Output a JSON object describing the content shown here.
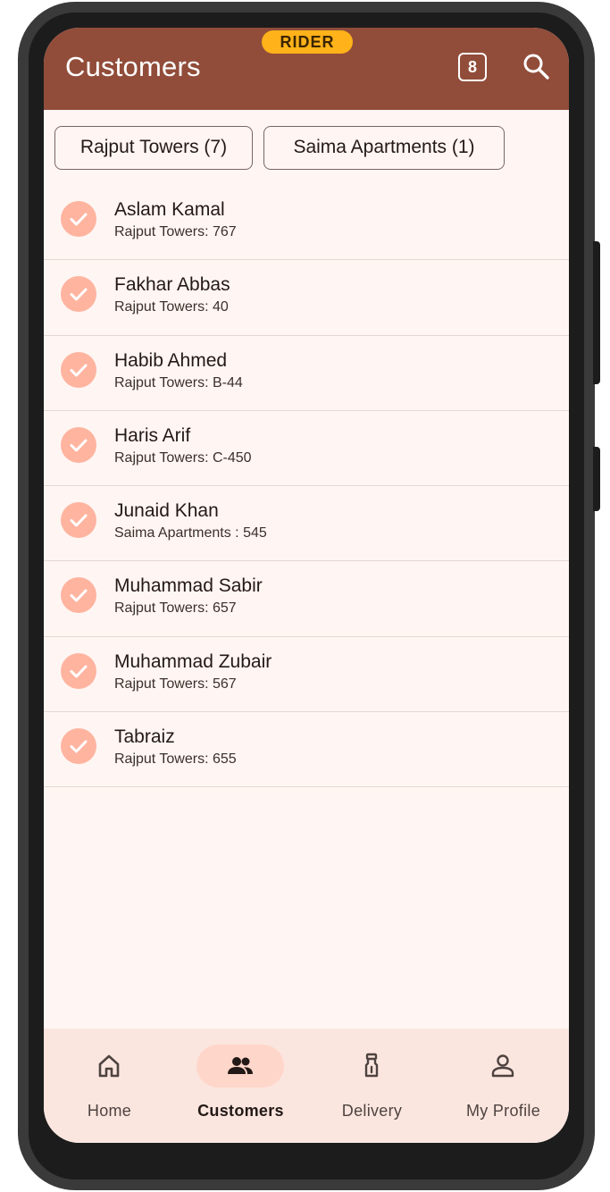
{
  "header": {
    "title": "Customers",
    "badge": "RIDER",
    "count": "8",
    "search_icon": "search-icon"
  },
  "filters": [
    {
      "label": "Rajput Towers (7)"
    },
    {
      "label": "Saima Apartments  (1)"
    }
  ],
  "customers": [
    {
      "name": "Aslam Kamal",
      "address": "Rajput Towers: 767"
    },
    {
      "name": "Fakhar Abbas",
      "address": "Rajput Towers: 40"
    },
    {
      "name": "Habib Ahmed",
      "address": "Rajput Towers: B-44"
    },
    {
      "name": "Haris Arif",
      "address": "Rajput Towers: C-450"
    },
    {
      "name": "Junaid Khan",
      "address": "Saima Apartments : 545"
    },
    {
      "name": "Muhammad Sabir",
      "address": "Rajput Towers: 657"
    },
    {
      "name": "Muhammad Zubair",
      "address": "Rajput Towers: 567"
    },
    {
      "name": "Tabraiz",
      "address": "Rajput Towers: 655"
    }
  ],
  "nav": [
    {
      "label": "Home",
      "icon": "home-icon"
    },
    {
      "label": "Customers",
      "icon": "people-icon"
    },
    {
      "label": "Delivery",
      "icon": "delivery-icon"
    },
    {
      "label": "My Profile",
      "icon": "person-icon"
    }
  ],
  "colors": {
    "appbar": "#914d3a",
    "badge": "#ffb21a",
    "check": "#ffb4a0",
    "nav_active": "#ffd6ca"
  }
}
